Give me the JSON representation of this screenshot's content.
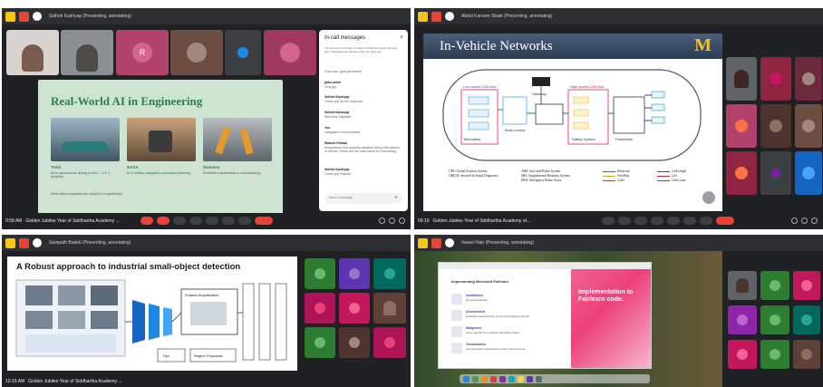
{
  "q1": {
    "title": "Sidheti Kashyap (Presenting, annotating)",
    "time": "9:58 AM",
    "meeting": "Golden Jubilee Year of Siddhartha Academy ...",
    "tiles": [
      {
        "initial": "",
        "color": "#7a5c4e"
      },
      {
        "initial": "",
        "color": "#6b6f73"
      },
      {
        "initial": "R",
        "color": "#c2185b",
        "bg": "#b0426b"
      },
      {
        "initial": "",
        "color": "#8d6e63",
        "bg": "#6d4c41"
      },
      {
        "initial": "",
        "color": "#1e88e5",
        "bg": "#3c4043"
      },
      {
        "initial": "",
        "color": "#c2185b",
        "bg": "#9e3a5e"
      }
    ],
    "slide": {
      "title": "Real-World AI in Engineering",
      "cards": [
        {
          "label": "Tesla",
          "desc": "AI for autonomous driving (Level 1 - 2.5 +) Autopilot."
        },
        {
          "label": "NASA",
          "desc": "AI in Martian navigation, exploration planning."
        },
        {
          "label": "Siemens",
          "desc": "Predictive maintenance in manufacturing."
        }
      ],
      "question": "What other companies are using AI in engineering?"
    },
    "messages": {
      "title": "In-call messages",
      "notice": "You can pin a message to make it visible for people who join later. Messages are deleted when the call ends.",
      "items": [
        {
          "name": "",
          "text": "Chat bots, gpts generative"
        },
        {
          "name": "jaiku anish",
          "text": "Chat gpt"
        },
        {
          "name": "Sidheti Kashyap",
          "text": "Thank you for the response"
        },
        {
          "name": "Sidheti Kashyap",
          "text": "Welcome Jagadish"
        },
        {
          "name": "You",
          "text": "Integration of renewables"
        },
        {
          "name": "Rakesh Patidar",
          "text": "temperature and humidity variation along with passed of all flow. These are the main factor for forecasting"
        },
        {
          "name": "Sidheti Kashyap",
          "text": "Thank you Rakesh"
        }
      ],
      "input_placeholder": "Send a message"
    }
  },
  "q2": {
    "title": "Abdul Kareem Shaik (Presenting, annotating)",
    "time": "09:19",
    "meeting": "Golden Jubilee Year of Siddhartha Academy of...",
    "slide": {
      "title": "In-Vehicle Networks",
      "logo": "M",
      "labels": [
        "Gateway",
        "Low speed CAN bus",
        "High speed CAN bus",
        "Telematics",
        "Body control",
        "Powertrain",
        "Safety System"
      ],
      "legend_left": [
        "GPS: Global Position System",
        "OBD-II: Second On-board Diagnostic",
        "SRS: Supplemental Restraint System",
        "EBA: Emergency Brake Assist"
      ],
      "legend_mid": [
        "ABS: Anti-skid Brake System",
        "SRS: Supplemental Restraint System",
        "EBA: Emergency Brake Assist"
      ],
      "legend_right": [
        "Ethernet",
        "FlexRay",
        "CAN",
        "CAN-High",
        "LIN",
        "CAN-Low"
      ]
    }
  },
  "q3": {
    "title": "Sampath Badeti (Presenting, annotating)",
    "time": "10:15 AM",
    "meeting": "Golden Jubilee Year of Siddhartha Academy ...",
    "slide": {
      "title": "A Robust approach to industrial small-object detection",
      "boxes": [
        "Feature Amplification",
        "Rpn",
        "Region Proposals"
      ]
    }
  },
  "q4": {
    "title": "Vasavi Nair (Presenting, annotating)",
    "slide": {
      "heading": "Implementing Microsoft Fairlearn",
      "steps": [
        {
          "title": "Installation",
          "desc": "pip install fairlearn"
        },
        {
          "title": "Assessment",
          "desc": "Evaluate model fairness across demographic groups"
        },
        {
          "title": "Mitigation",
          "desc": "Apply algorithms to address identified biases"
        },
        {
          "title": "Visualization",
          "desc": "Use interactive dashboard to track improvements"
        }
      ],
      "right_title": "Implementation to Fairlearn code."
    }
  },
  "colors": {
    "meet_bg": "#202124",
    "hang": "#ea4335",
    "slide1_bg": "#cfe3d3",
    "slide1_title": "#2e7d4f"
  }
}
